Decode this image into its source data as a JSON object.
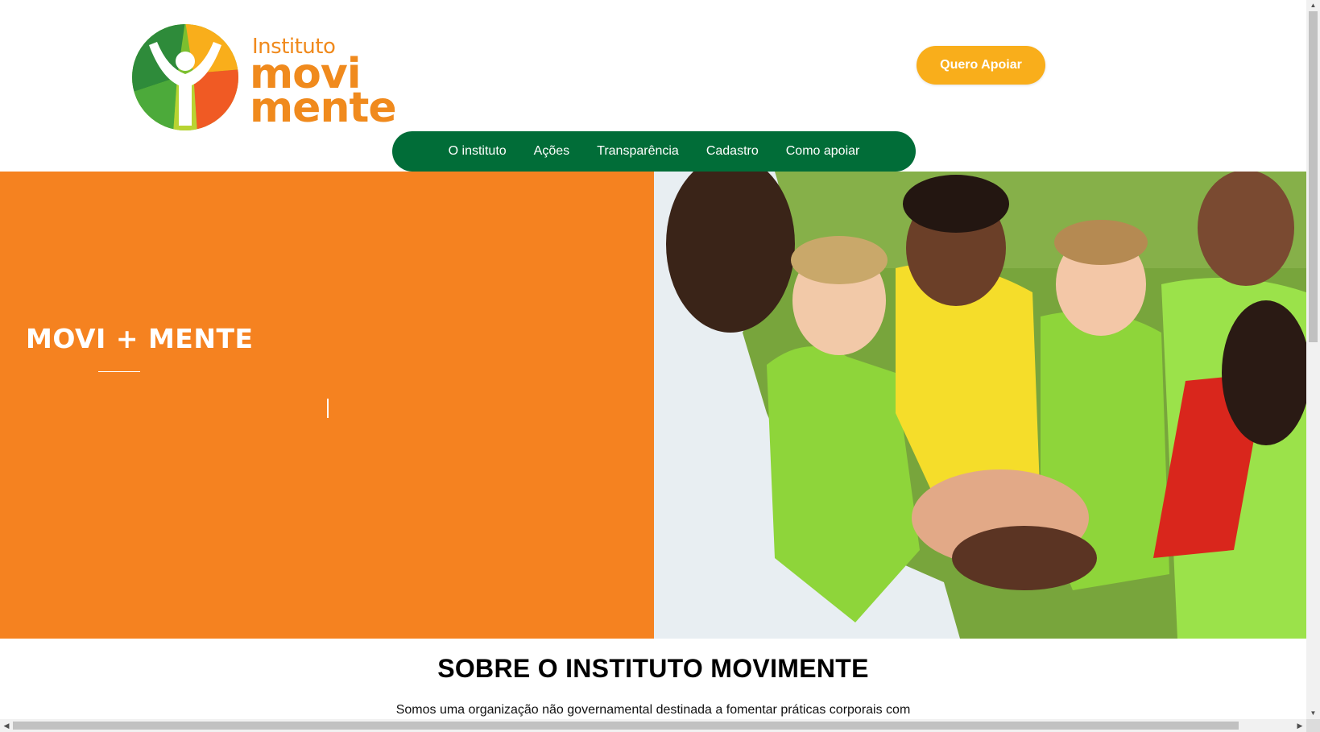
{
  "logo": {
    "small": "Instituto",
    "line1": "movi",
    "line2": "mente"
  },
  "header": {
    "cta_label": "Quero Apoiar"
  },
  "nav": {
    "items": [
      "O instituto",
      "Ações",
      "Transparência",
      "Cadastro",
      "Como apoiar"
    ]
  },
  "hero": {
    "title": "MOVI + MENTE",
    "photo": "children-team-huddle-photo"
  },
  "about": {
    "title": "SOBRE O INSTITUTO MOVIMENTE",
    "text": "Somos uma organização não governamental destinada a fomentar práticas corporais com"
  },
  "colors": {
    "brand_orange": "#f58220",
    "cta_yellow": "#f9ae1b",
    "nav_green": "#016d38"
  }
}
